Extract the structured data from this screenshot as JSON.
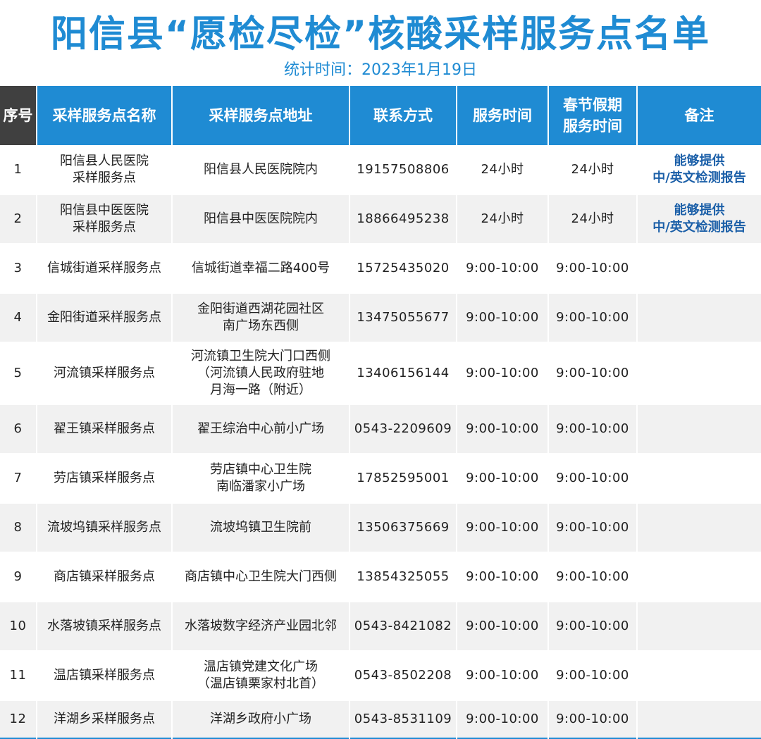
{
  "header": {
    "title": "阳信县“愿检尽检”核酸采样服务点名单",
    "subtitle": "统计时间：2023年1月19日"
  },
  "table": {
    "columns": [
      {
        "lines": [
          "序号"
        ]
      },
      {
        "lines": [
          "采样服务点名称"
        ]
      },
      {
        "lines": [
          "采样服务点地址"
        ]
      },
      {
        "lines": [
          "联系方式"
        ]
      },
      {
        "lines": [
          "服务时间"
        ]
      },
      {
        "lines": [
          "春节假期",
          "服务时间"
        ]
      },
      {
        "lines": [
          "备注"
        ]
      }
    ],
    "rows": [
      {
        "seq": "1",
        "name": [
          "阳信县人民医院",
          "采样服务点"
        ],
        "address": [
          "阳信县人民医院院内"
        ],
        "phone": "19157508806",
        "hours": "24小时",
        "holiday": "24小时",
        "note": [
          "能够提供",
          "中/英文检测报告"
        ]
      },
      {
        "seq": "2",
        "name": [
          "阳信县中医医院",
          "采样服务点"
        ],
        "address": [
          "阳信县中医医院院内"
        ],
        "phone": "18866495238",
        "hours": "24小时",
        "holiday": "24小时",
        "note": [
          "能够提供",
          "中/英文检测报告"
        ]
      },
      {
        "seq": "3",
        "name": [
          "信城街道采样服务点"
        ],
        "address": [
          "信城街道幸福二路400号"
        ],
        "phone": "15725435020",
        "hours": "9:00-10:00",
        "holiday": "9:00-10:00",
        "note": []
      },
      {
        "seq": "4",
        "name": [
          "金阳街道采样服务点"
        ],
        "address": [
          "金阳街道西湖花园社区",
          "南广场东西侧"
        ],
        "phone": "13475055677",
        "hours": "9:00-10:00",
        "holiday": "9:00-10:00",
        "note": []
      },
      {
        "seq": "5",
        "name": [
          "河流镇采样服务点"
        ],
        "address": [
          "河流镇卫生院大门口西侧",
          "（河流镇人民政府驻地",
          "月海一路（附近）"
        ],
        "phone": "13406156144",
        "hours": "9:00-10:00",
        "holiday": "9:00-10:00",
        "note": []
      },
      {
        "seq": "6",
        "name": [
          "翟王镇采样服务点"
        ],
        "address": [
          "翟王综治中心前小广场"
        ],
        "phone": "0543-2209609",
        "hours": "9:00-10:00",
        "holiday": "9:00-10:00",
        "note": []
      },
      {
        "seq": "7",
        "name": [
          "劳店镇采样服务点"
        ],
        "address": [
          "劳店镇中心卫生院",
          "南临潘家小广场"
        ],
        "phone": "17852595001",
        "hours": "9:00-10:00",
        "holiday": "9:00-10:00",
        "note": []
      },
      {
        "seq": "8",
        "name": [
          "流坡坞镇采样服务点"
        ],
        "address": [
          "流坡坞镇卫生院前"
        ],
        "phone": "13506375669",
        "hours": "9:00-10:00",
        "holiday": "9:00-10:00",
        "note": []
      },
      {
        "seq": "9",
        "name": [
          "商店镇采样服务点"
        ],
        "address": [
          "商店镇中心卫生院大门西侧"
        ],
        "phone": "13854325055",
        "hours": "9:00-10:00",
        "holiday": "9:00-10:00",
        "note": []
      },
      {
        "seq": "10",
        "name": [
          "水落坡镇采样服务点"
        ],
        "address": [
          "水落坡数字经济产业园北邻"
        ],
        "phone": "0543-8421082",
        "hours": "9:00-10:00",
        "holiday": "9:00-10:00",
        "note": []
      },
      {
        "seq": "11",
        "name": [
          "温店镇采样服务点"
        ],
        "address": [
          "温店镇党建文化广场",
          "（温店镇栗家村北首）"
        ],
        "phone": "0543-8502208",
        "hours": "9:00-10:00",
        "holiday": "9:00-10:00",
        "note": []
      },
      {
        "seq": "12",
        "name": [
          "洋湖乡采样服务点"
        ],
        "address": [
          "洋湖乡政府小广场"
        ],
        "phone": "0543-8531109",
        "hours": "9:00-10:00",
        "holiday": "9:00-10:00",
        "note": []
      }
    ]
  }
}
